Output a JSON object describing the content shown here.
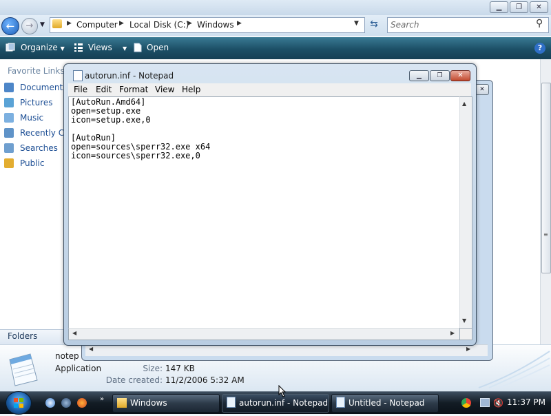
{
  "explorer": {
    "address": {
      "crumbs": [
        "Computer",
        "Local Disk (C:)",
        "Windows"
      ]
    },
    "search_placeholder": "Search",
    "toolbar": {
      "organize": "Organize",
      "views": "Views",
      "open": "Open"
    },
    "nav": {
      "heading": "Favorite Links",
      "items": [
        {
          "label": "Documents",
          "icon": "documents-icon",
          "color": "#4d86c8"
        },
        {
          "label": "Pictures",
          "icon": "pictures-icon",
          "color": "#5aa3d6"
        },
        {
          "label": "Music",
          "icon": "music-icon",
          "color": "#7cb0e0"
        },
        {
          "label": "Recently Ch",
          "icon": "recent-icon",
          "color": "#5f93c8"
        },
        {
          "label": "Searches",
          "icon": "searches-icon",
          "color": "#6f9fcf"
        },
        {
          "label": "Public",
          "icon": "public-folder-icon",
          "color": "#e3ad30"
        }
      ],
      "folders_label": "Folders"
    },
    "details": {
      "name": "notep",
      "type": "Application",
      "size_label": "Size:",
      "size_value": "147 KB",
      "created_label": "Date created:",
      "created_value": "11/2/2006 5:32 AM"
    }
  },
  "notepad": {
    "title": "autorun.inf - Notepad",
    "menu": [
      "File",
      "Edit",
      "Format",
      "View",
      "Help"
    ],
    "content": "[AutoRun.Amd64]\nopen=setup.exe\nicon=setup.exe,0\n\n[AutoRun]\nopen=sources\\sperr32.exe x64\nicon=sources\\sperr32.exe,0"
  },
  "taskbar": {
    "tasks": [
      {
        "label": "Windows",
        "icon": "folder-icon"
      },
      {
        "label": "autorun.inf - Notepad",
        "icon": "notepad-icon",
        "active": true
      },
      {
        "label": "Untitled - Notepad",
        "icon": "notepad-icon"
      }
    ],
    "more": "»",
    "clock": "11:37 PM"
  }
}
